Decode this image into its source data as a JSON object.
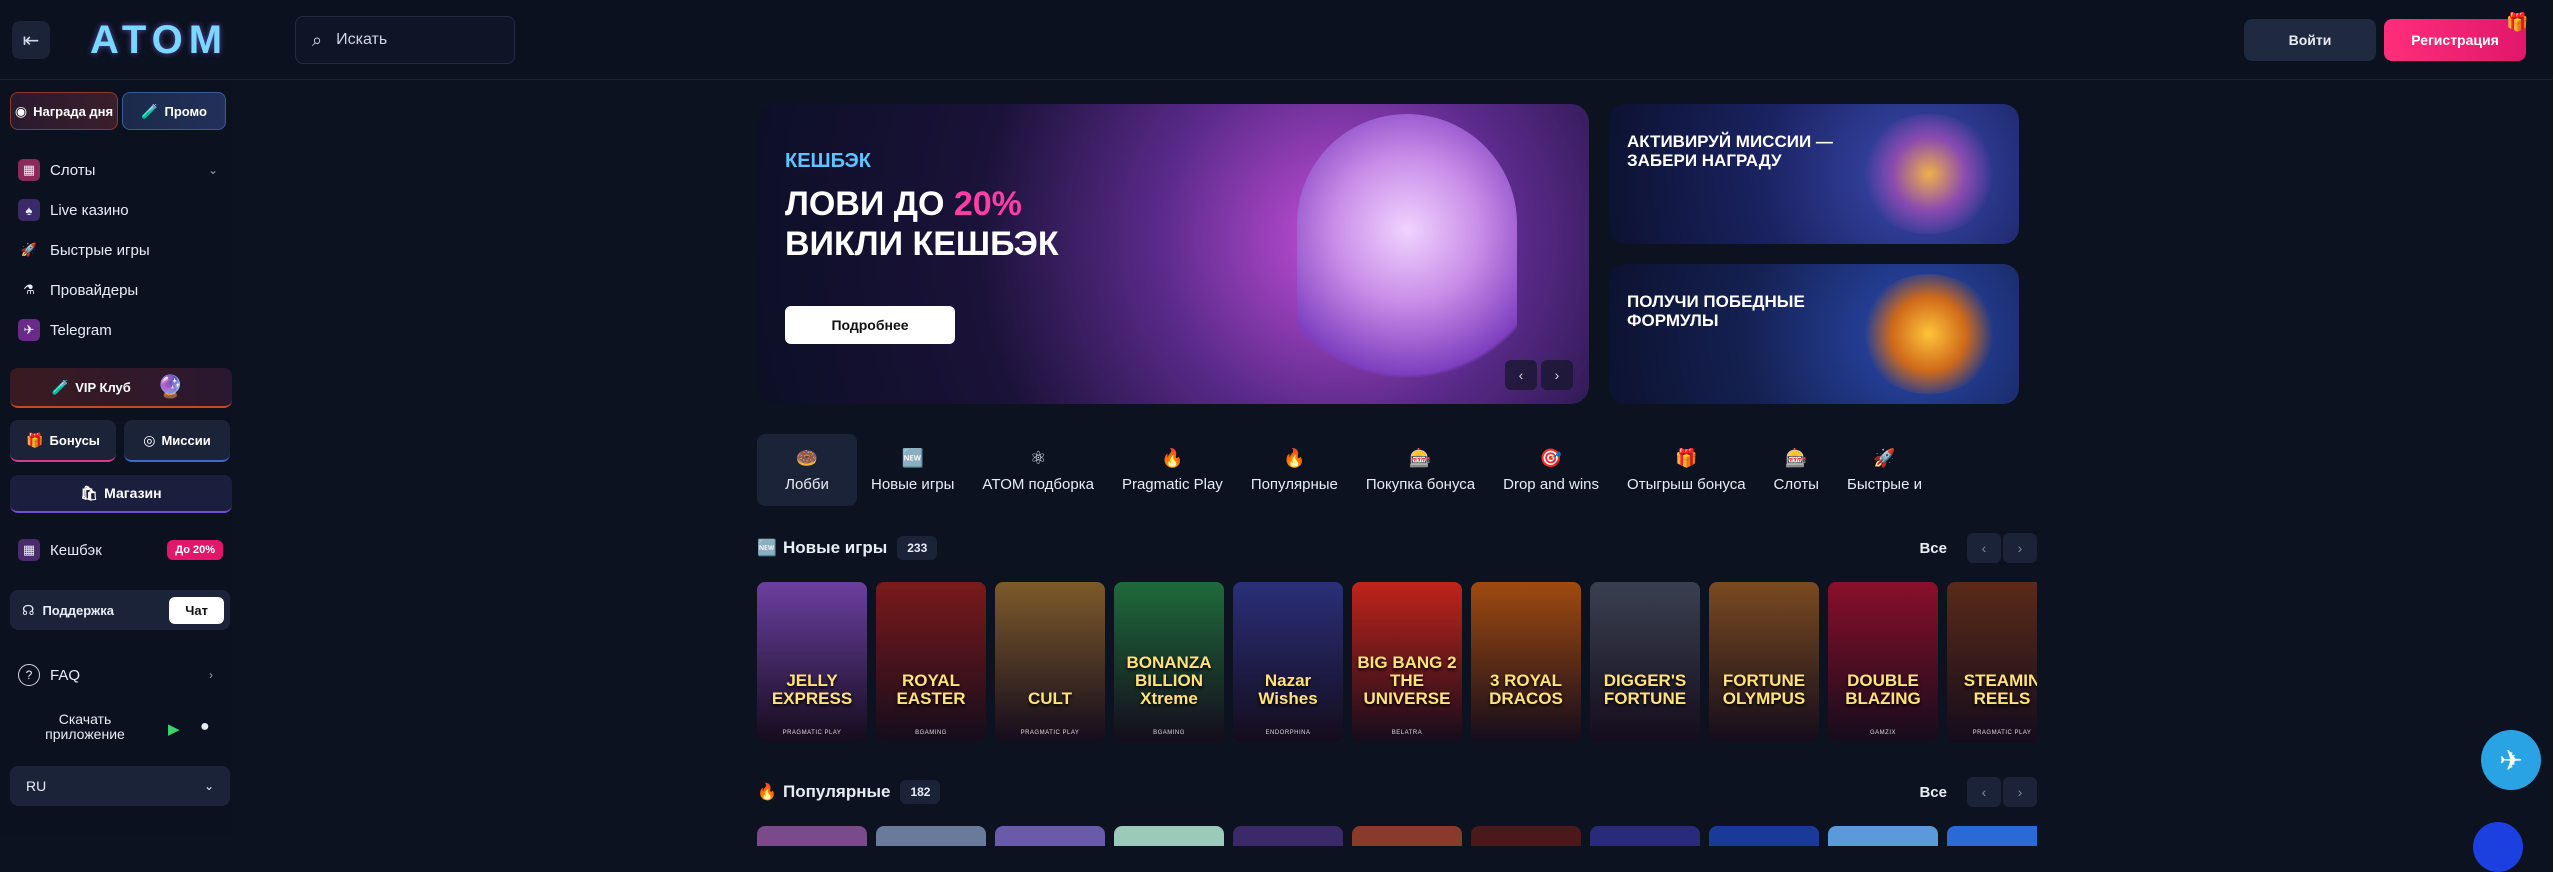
{
  "header": {
    "logo": "ATOM",
    "search_placeholder": "Искать",
    "login": "Войти",
    "register": "Регистрация"
  },
  "sidebar": {
    "chips": {
      "daily_reward": "Награда дня",
      "promo": "Промо"
    },
    "nav": [
      {
        "label": "Слоты",
        "icon": "slots-icon"
      },
      {
        "label": "Live казино",
        "icon": "live-casino-icon"
      },
      {
        "label": "Быстрые игры",
        "icon": "rocket-icon"
      },
      {
        "label": "Провайдеры",
        "icon": "flask-icon"
      },
      {
        "label": "Telegram",
        "icon": "telegram-icon"
      }
    ],
    "vip": "VIP Клуб",
    "bonuses": "Бонусы",
    "missions": "Миссии",
    "shop": "Магазин",
    "cashback": "Кешбэк",
    "cashback_badge": "До 20%",
    "support": "Поддержка",
    "chat": "Чат",
    "faq": "FAQ",
    "download": "Скачать приложение",
    "language": "RU"
  },
  "hero": {
    "tag": "КЕШБЭК",
    "line1": "ЛОВИ ДО ",
    "percent": "20%",
    "line2": "ВИКЛИ КЕШБЭК",
    "button": "Подробнее"
  },
  "promos": {
    "missions": "АКТИВИРУЙ МИССИИ — ЗАБЕРИ НАГРАДУ",
    "formulas": "ПОЛУЧИ ПОБЕДНЫЕ ФОРМУЛЫ"
  },
  "categories": [
    {
      "label": "Лобби",
      "icon": "🍩"
    },
    {
      "label": "Новые игры",
      "icon": "🆕"
    },
    {
      "label": "ATOM подборка",
      "icon": "⚛"
    },
    {
      "label": "Pragmatic Play",
      "icon": "🔥"
    },
    {
      "label": "Популярные",
      "icon": "🔥"
    },
    {
      "label": "Покупка бонуса",
      "icon": "🎰"
    },
    {
      "label": "Drop and wins",
      "icon": "🎯"
    },
    {
      "label": "Отыгрыш бонуса",
      "icon": "🎁"
    },
    {
      "label": "Слоты",
      "icon": "🎰"
    },
    {
      "label": "Быстрые и",
      "icon": "🚀"
    }
  ],
  "sections": {
    "new_games": {
      "title": "Новые игры",
      "count": "233",
      "all": "Все"
    },
    "popular": {
      "title": "Популярные",
      "count": "182",
      "all": "Все"
    }
  },
  "games": [
    {
      "name": "JELLY EXPRESS",
      "provider": "PRAGMATIC PLAY",
      "color": "#6b3fa0"
    },
    {
      "name": "ROYAL EASTER",
      "provider": "BGAMING",
      "color": "#7a1a1a"
    },
    {
      "name": "CULT",
      "provider": "PRAGMATIC PLAY",
      "color": "#7d5a2a"
    },
    {
      "name": "BONANZA BILLION Xtreme",
      "provider": "BGAMING",
      "color": "#1f6a3a"
    },
    {
      "name": "Nazar Wishes",
      "provider": "ENDORPHINA",
      "color": "#2a2f78"
    },
    {
      "name": "BIG BANG 2 THE UNIVERSE",
      "provider": "BELATRA",
      "color": "#c0241a"
    },
    {
      "name": "3 ROYAL DRACOS",
      "provider": "",
      "color": "#a04a10"
    },
    {
      "name": "DIGGER'S FORTUNE",
      "provider": "",
      "color": "#3a4050"
    },
    {
      "name": "FORTUNE OLYMPUS",
      "provider": "",
      "color": "#7a4a20"
    },
    {
      "name": "DOUBLE BLAZING",
      "provider": "GAMZIX",
      "color": "#8a0f2a"
    },
    {
      "name": "STEAMIN REELS",
      "provider": "PRAGMATIC PLAY",
      "color": "#5a2a18"
    }
  ],
  "colors": {
    "accent_pink": "#ff2e7a",
    "accent_blue": "#5fc3ff",
    "bg": "#0d1220"
  }
}
